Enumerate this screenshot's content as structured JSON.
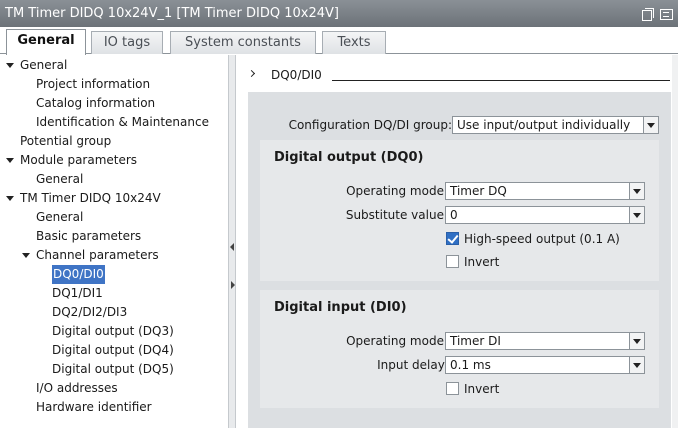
{
  "window": {
    "title": "TM Timer DIDQ 10x24V_1 [TM Timer DIDQ 10x24V]",
    "icons": [
      "restore-icon",
      "menu-icon"
    ]
  },
  "tabs": [
    {
      "label": "General",
      "active": true
    },
    {
      "label": "IO tags",
      "active": false
    },
    {
      "label": "System constants",
      "active": false
    },
    {
      "label": "Texts",
      "active": false
    }
  ],
  "tree": [
    {
      "label": "General",
      "level": 0,
      "expanded": true
    },
    {
      "label": "Project information",
      "level": 1
    },
    {
      "label": "Catalog information",
      "level": 1
    },
    {
      "label": "Identification & Maintenance",
      "level": 1
    },
    {
      "label": "Potential group",
      "level": 0
    },
    {
      "label": "Module parameters",
      "level": 0,
      "expanded": true
    },
    {
      "label": "General",
      "level": 1
    },
    {
      "label": "TM Timer DIDQ 10x24V",
      "level": 0,
      "expanded": true
    },
    {
      "label": "General",
      "level": 1
    },
    {
      "label": "Basic parameters",
      "level": 1
    },
    {
      "label": "Channel parameters",
      "level": 1,
      "expanded": true
    },
    {
      "label": "DQ0/DI0",
      "level": 2,
      "selected": true
    },
    {
      "label": "DQ1/DI1",
      "level": 2
    },
    {
      "label": "DQ2/DI2/DI3",
      "level": 2
    },
    {
      "label": "Digital output (DQ3)",
      "level": 2
    },
    {
      "label": "Digital output (DQ4)",
      "level": 2
    },
    {
      "label": "Digital output (DQ5)",
      "level": 2
    },
    {
      "label": "I/O addresses",
      "level": 1
    },
    {
      "label": "Hardware identifier",
      "level": 1
    }
  ],
  "content": {
    "section_title": "DQ0/DI0",
    "config": {
      "label": "Configuration DQ/DI group:",
      "value": "Use input/output individually"
    },
    "digital_output": {
      "title": "Digital output (DQ0)",
      "operating_mode": {
        "label": "Operating mode:",
        "value": "Timer DQ"
      },
      "substitute_value": {
        "label": "Substitute value:",
        "value": "0"
      },
      "high_speed": {
        "label": "High-speed output (0.1 A)",
        "checked": true
      },
      "invert": {
        "label": "Invert",
        "checked": false
      }
    },
    "digital_input": {
      "title": "Digital input (DI0)",
      "operating_mode": {
        "label": "Operating mode:",
        "value": "Timer DI"
      },
      "input_delay": {
        "label": "Input delay:",
        "value": "0.1 ms"
      },
      "invert": {
        "label": "Invert",
        "checked": false
      }
    }
  },
  "colors": {
    "title_bar": "#7a8086",
    "selection": "#3f74c5",
    "panel": "#dcdfe2",
    "group": "#e6e8ea",
    "checkbox_checked": "#2f6fc4"
  }
}
